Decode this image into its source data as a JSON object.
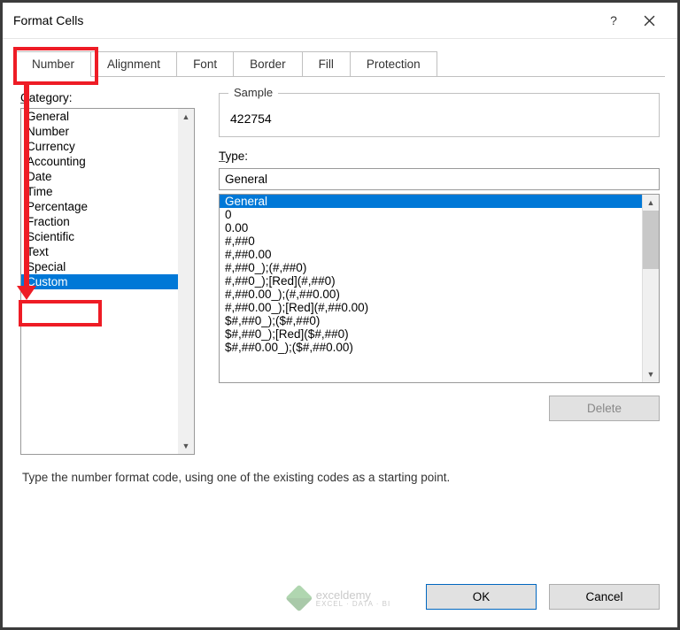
{
  "window": {
    "title": "Format Cells",
    "help": "?",
    "close": "✕"
  },
  "tabs": [
    "Number",
    "Alignment",
    "Font",
    "Border",
    "Fill",
    "Protection"
  ],
  "activeTab": 0,
  "categoryLabel": "Category:",
  "categories": [
    "General",
    "Number",
    "Currency",
    "Accounting",
    "Date",
    "Time",
    "Percentage",
    "Fraction",
    "Scientific",
    "Text",
    "Special",
    "Custom"
  ],
  "selectedCategory": 11,
  "sample": {
    "legend": "Sample",
    "value": "422754"
  },
  "typeLabel": "Type:",
  "typeValue": "General",
  "typeList": [
    "General",
    "0",
    "0.00",
    "#,##0",
    "#,##0.00",
    "#,##0_);(#,##0)",
    "#,##0_);[Red](#,##0)",
    "#,##0.00_);(#,##0.00)",
    "#,##0.00_);[Red](#,##0.00)",
    "$#,##0_);($#,##0)",
    "$#,##0_);[Red]($#,##0)",
    "$#,##0.00_);($#,##0.00)"
  ],
  "selectedType": 0,
  "deleteLabel": "Delete",
  "description": "Type the number format code, using one of the existing codes as a starting point.",
  "okLabel": "OK",
  "cancelLabel": "Cancel",
  "watermark": {
    "name": "exceldemy",
    "sub": "EXCEL · DATA · BI"
  }
}
